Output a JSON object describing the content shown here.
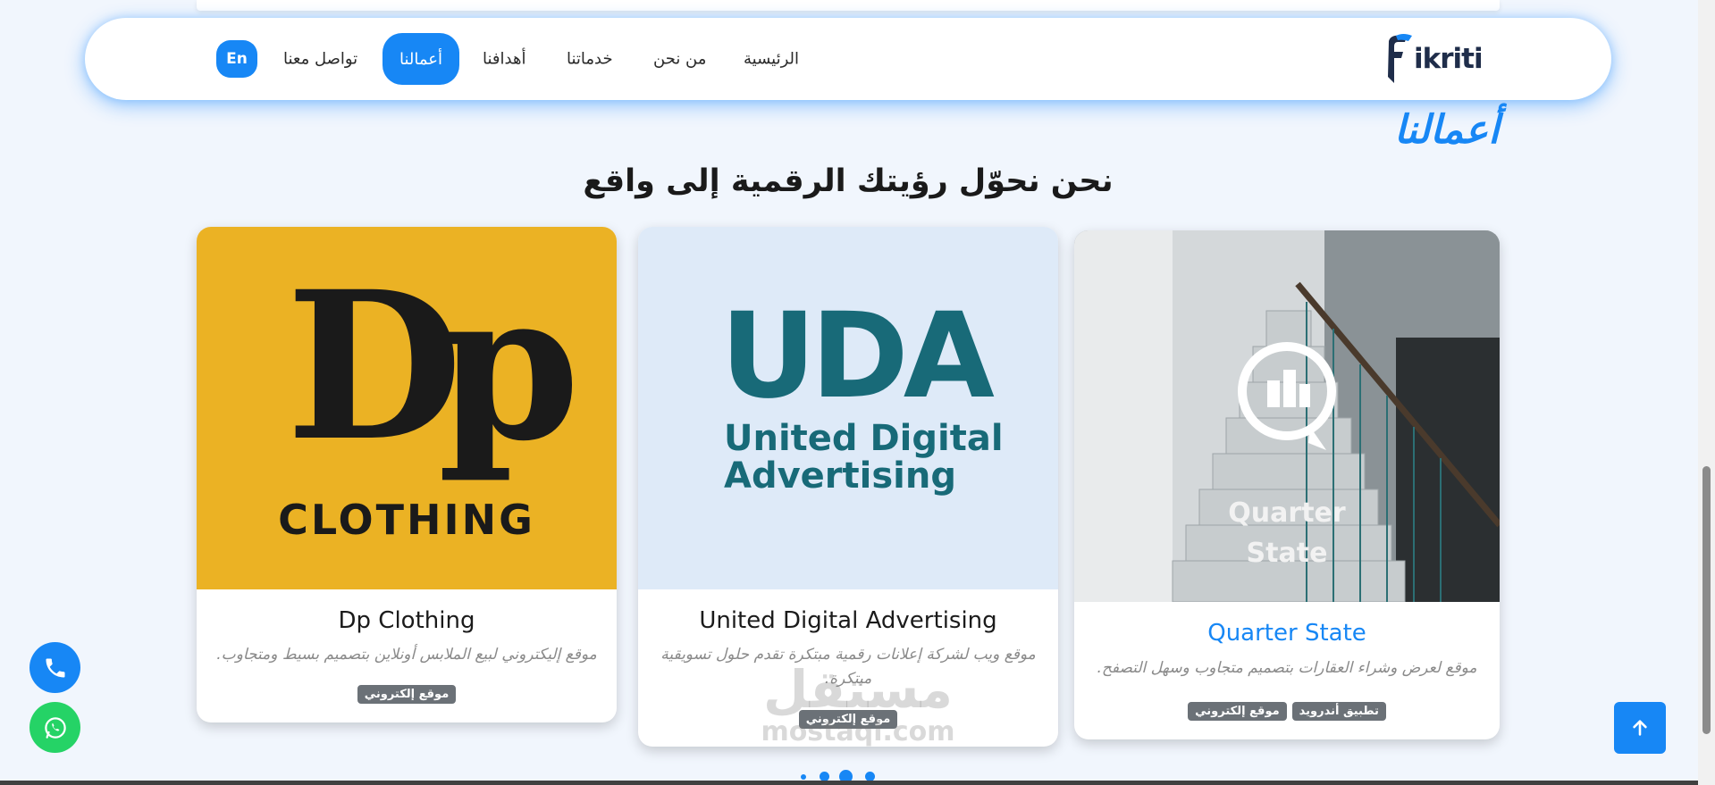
{
  "nav": {
    "logo_text": "ikriti",
    "items": [
      {
        "label": "الرئيسية"
      },
      {
        "label": "من نحن"
      },
      {
        "label": "خدماتنا"
      },
      {
        "label": "أهدافنا"
      },
      {
        "label": "أعمالنا"
      },
      {
        "label": "تواصل معنا"
      }
    ],
    "lang": "En"
  },
  "section": {
    "title": "أعمالنا",
    "subtitle": "نحن نحوّل رؤيتك الرقمية إلى واقع"
  },
  "cards": [
    {
      "image_text_1": "Dp",
      "image_text_2": "CLOTHING",
      "title": "Dp Clothing",
      "desc": "موقع إليكتروني لبيع الملابس أونلاين بتصميم بسيط ومتجاوب.",
      "tags": [
        "موقع إلكتروني"
      ]
    },
    {
      "image_text_1": "UDA",
      "image_text_2": "United Digital",
      "image_text_3": "Advertising",
      "title": "United Digital Advertising",
      "desc": "موقع ويب لشركة إعلانات رقمية مبتكرة تقدم حلول تسويقية مبتكرة.",
      "tags": [
        "موقع إلكتروني"
      ]
    },
    {
      "image_text_1": "Quarter",
      "image_text_2": "State",
      "title": "Quarter State",
      "desc": "موقع لعرض وشراء العقارات بتصميم متجاوب وسهل التصفح.",
      "tags": [
        "تطبيق أندرويد",
        "موقع إلكتروني"
      ]
    }
  ],
  "carousel": {
    "dots": 4,
    "active_index": 2
  },
  "watermark": {
    "ar": "مستقل",
    "en": "mostaql.com"
  },
  "colors": {
    "accent": "#1787f5",
    "whatsapp": "#25d366",
    "tag": "#6b7177",
    "card3_title": "#1787f5"
  }
}
